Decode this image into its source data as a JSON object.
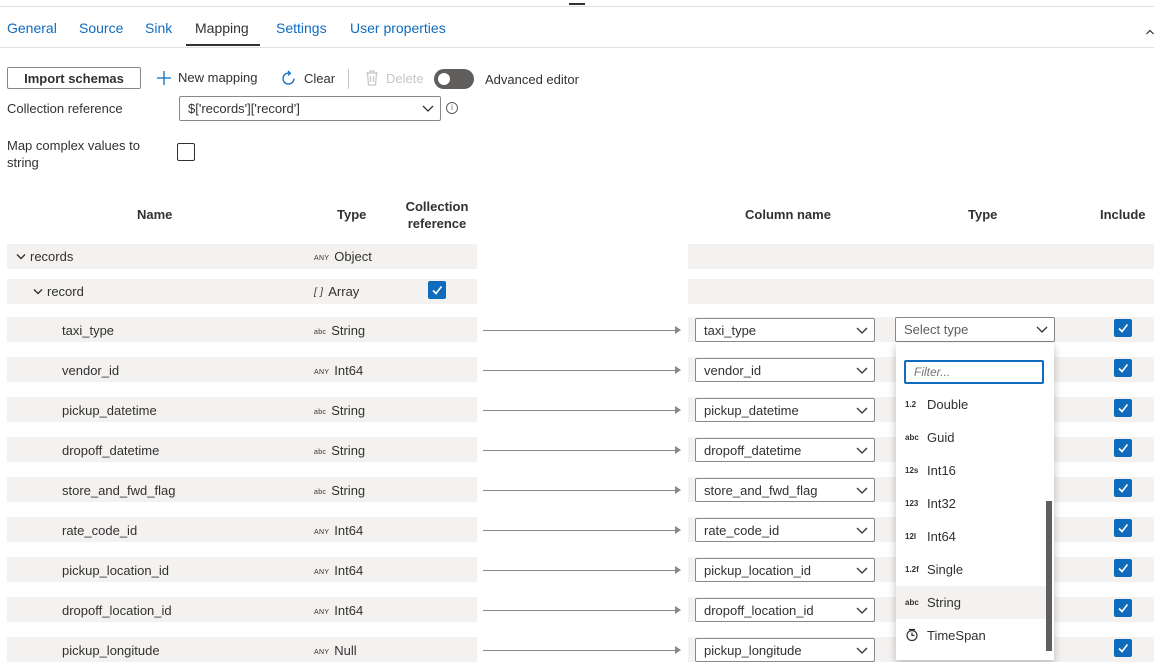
{
  "tabs": [
    {
      "label": "General"
    },
    {
      "label": "Source"
    },
    {
      "label": "Sink"
    },
    {
      "label": "Mapping"
    },
    {
      "label": "Settings"
    },
    {
      "label": "User properties"
    }
  ],
  "active_tab": "Mapping",
  "toolbar": {
    "import_schemas": "Import schemas",
    "new_mapping": "New mapping",
    "clear": "Clear",
    "delete": "Delete",
    "advanced_editor": "Advanced editor",
    "advanced_editor_on": false
  },
  "collection_reference": {
    "label": "Collection reference",
    "value": "$['records']['record']"
  },
  "map_complex": {
    "label": "Map complex values to string",
    "checked": false
  },
  "headers": {
    "name": "Name",
    "type": "Type",
    "collection_reference": "Collection reference",
    "column_name": "Column name",
    "sink_type": "Type",
    "include": "Include"
  },
  "tree": [
    {
      "name": "records",
      "badge": "ANY",
      "type": "Object"
    },
    {
      "name": "record",
      "badge": "[ ]",
      "type": "Array",
      "collection_reference": true
    }
  ],
  "rows": [
    {
      "name": "taxi_type",
      "badge": "abc",
      "type": "String",
      "column": "taxi_type",
      "include": true
    },
    {
      "name": "vendor_id",
      "badge": "ANY",
      "type": "Int64",
      "column": "vendor_id",
      "include": true
    },
    {
      "name": "pickup_datetime",
      "badge": "abc",
      "type": "String",
      "column": "pickup_datetime",
      "include": true
    },
    {
      "name": "dropoff_datetime",
      "badge": "abc",
      "type": "String",
      "column": "dropoff_datetime",
      "include": true
    },
    {
      "name": "store_and_fwd_flag",
      "badge": "abc",
      "type": "String",
      "column": "store_and_fwd_flag",
      "include": true
    },
    {
      "name": "rate_code_id",
      "badge": "ANY",
      "type": "Int64",
      "column": "rate_code_id",
      "include": true
    },
    {
      "name": "pickup_location_id",
      "badge": "ANY",
      "type": "Int64",
      "column": "pickup_location_id",
      "include": true
    },
    {
      "name": "dropoff_location_id",
      "badge": "ANY",
      "type": "Int64",
      "column": "dropoff_location_id",
      "include": true
    },
    {
      "name": "pickup_longitude",
      "badge": "ANY",
      "type": "Null",
      "column": "pickup_longitude",
      "include": true
    }
  ],
  "type_dropdown": {
    "placeholder": "Select type",
    "filter_placeholder": "Filter...",
    "options": [
      {
        "icon": "1.2",
        "label": "Double"
      },
      {
        "icon": "abc",
        "label": "Guid"
      },
      {
        "icon": "12s",
        "label": "Int16"
      },
      {
        "icon": "123",
        "label": "Int32"
      },
      {
        "icon": "12l",
        "label": "Int64"
      },
      {
        "icon": "1.2f",
        "label": "Single"
      },
      {
        "icon": "abc",
        "label": "String",
        "highlighted": true
      },
      {
        "icon": "clock",
        "label": "TimeSpan"
      }
    ]
  },
  "colors": {
    "accent": "#0f6cbd",
    "row_background": "#f3f2f1",
    "text": "#323130"
  }
}
